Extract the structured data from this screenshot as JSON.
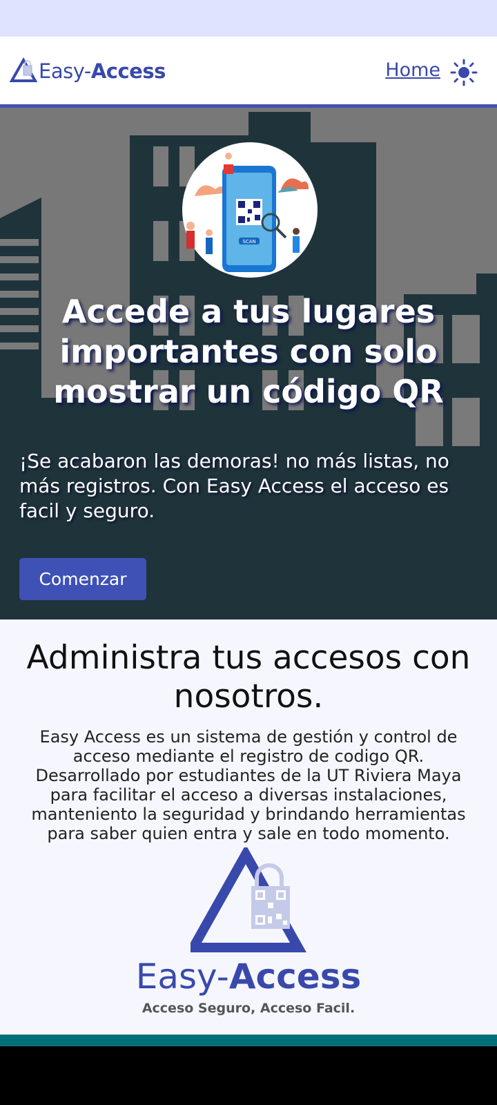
{
  "navbar": {
    "brand_prefix": "Easy-",
    "brand_suffix": "Access",
    "home_link": "Home",
    "theme_icon": "sun-icon"
  },
  "hero": {
    "title": "Accede a tus lugares importantes con solo mostrar un código QR",
    "subtitle": "¡Se acabaron las demoras! no más listas, no más registros. Con Easy Access el acceso es facil y seguro.",
    "cta_label": "Comenzar",
    "scan_label": "SCAN"
  },
  "about": {
    "title": "Administra tus accesos con nosotros.",
    "text": "Easy Access es un sistema de gestión y control de acceso mediante el registro de codigo QR. Desarrollado por estudiantes de la UT Riviera Maya para facilitar el acceso a diversas instalaciones, manteniento la seguridad y brindando herramientas para saber quien entra y sale en todo momento.",
    "logo_prefix": "Easy-",
    "logo_suffix": "Access",
    "tagline": "Acceso Seguro, Acceso Facil."
  },
  "colors": {
    "primary": "#3f51b5",
    "hero_bg": "#797878",
    "building_dark": "#1f333b",
    "footer_band": "#006f7a"
  }
}
